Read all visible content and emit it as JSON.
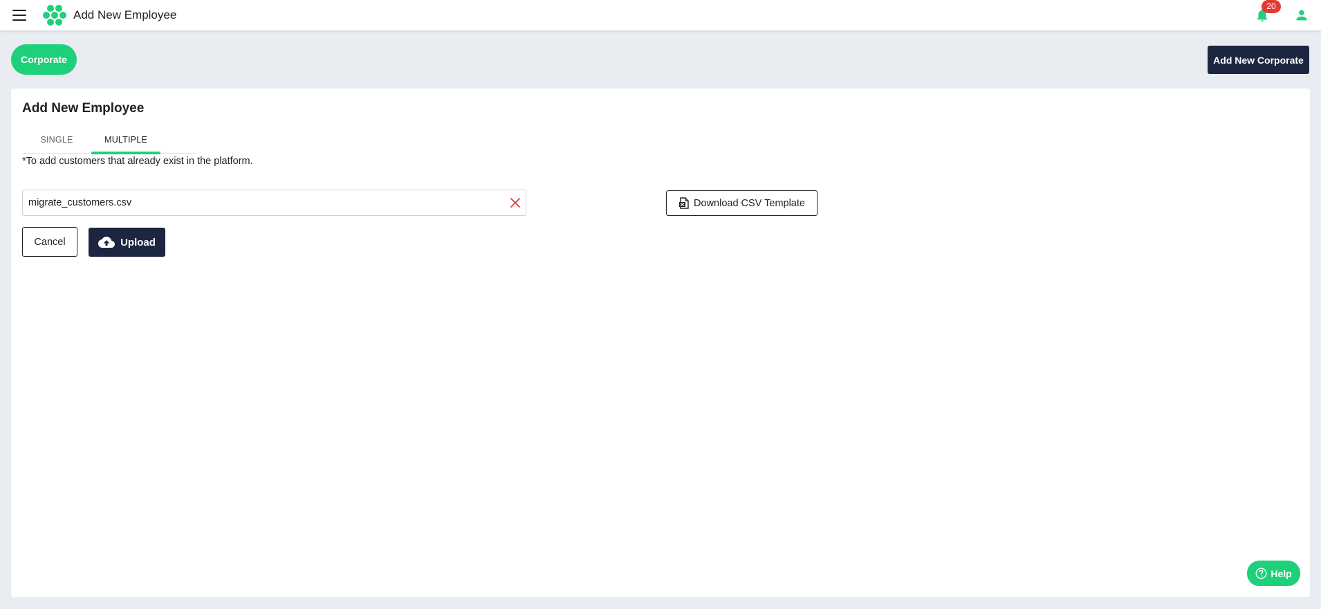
{
  "header": {
    "title": "Add New Employee",
    "notification_count": "20"
  },
  "subheader": {
    "corporate_label": "Corporate",
    "add_corporate_label": "Add New Corporate"
  },
  "card": {
    "title": "Add New Employee",
    "tabs": [
      {
        "label": "SINGLE",
        "active": false
      },
      {
        "label": "MULTIPLE",
        "active": true
      }
    ],
    "note": "*To add customers that already exist in the platform.",
    "file_value": "migrate_customers.csv",
    "download_label": "Download CSV Template",
    "cancel_label": "Cancel",
    "upload_label": "Upload"
  },
  "help_label": "Help",
  "colors": {
    "accent": "#1fd07b",
    "dark": "#1d2640",
    "badge": "#e53935",
    "background": "#e9ecf1"
  },
  "icons": [
    "menu-icon",
    "logo-icon",
    "bell-icon",
    "user-icon",
    "close-icon",
    "csv-file-icon",
    "cloud-upload-icon",
    "help-circle-icon"
  ]
}
